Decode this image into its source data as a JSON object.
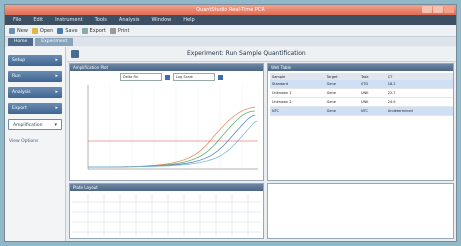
{
  "window": {
    "title": "QuantStudio Real-Time PCR"
  },
  "menu": [
    "File",
    "Edit",
    "Instrument",
    "Tools",
    "Analysis",
    "Window",
    "Help"
  ],
  "toolbar": {
    "items": [
      "New",
      "Open",
      "Save",
      "Export",
      "Print"
    ]
  },
  "tabs": [
    "Home",
    "Experiment"
  ],
  "sidebar": {
    "items": [
      {
        "label": "Setup"
      },
      {
        "label": "Run"
      },
      {
        "label": "Analysis"
      },
      {
        "label": "Export"
      },
      {
        "label": "Amplification",
        "selected": true
      }
    ],
    "note": "View Options"
  },
  "main": {
    "title": "Experiment: Run Sample Quantification",
    "plot_panel_title": "Amplification Plot",
    "plot_ctrl_1": "Delta Rn",
    "plot_ctrl_2": "Log Scale",
    "table_panel_title": "Well Table",
    "table_headers": [
      "Sample",
      "Target",
      "Task",
      "CT"
    ],
    "rows": [
      {
        "sample": "Standard",
        "target": "Gene",
        "task": "STD",
        "ct": "18.2"
      },
      {
        "sample": "Unknown 1",
        "target": "Gene",
        "task": "UNK",
        "ct": "22.7"
      },
      {
        "sample": "Unknown 2",
        "target": "Gene",
        "task": "UNK",
        "ct": "24.9"
      },
      {
        "sample": "NTC",
        "target": "Gene",
        "task": "NTC",
        "ct": "Undetermined"
      }
    ],
    "well_panel_title": "Plate Layout"
  }
}
